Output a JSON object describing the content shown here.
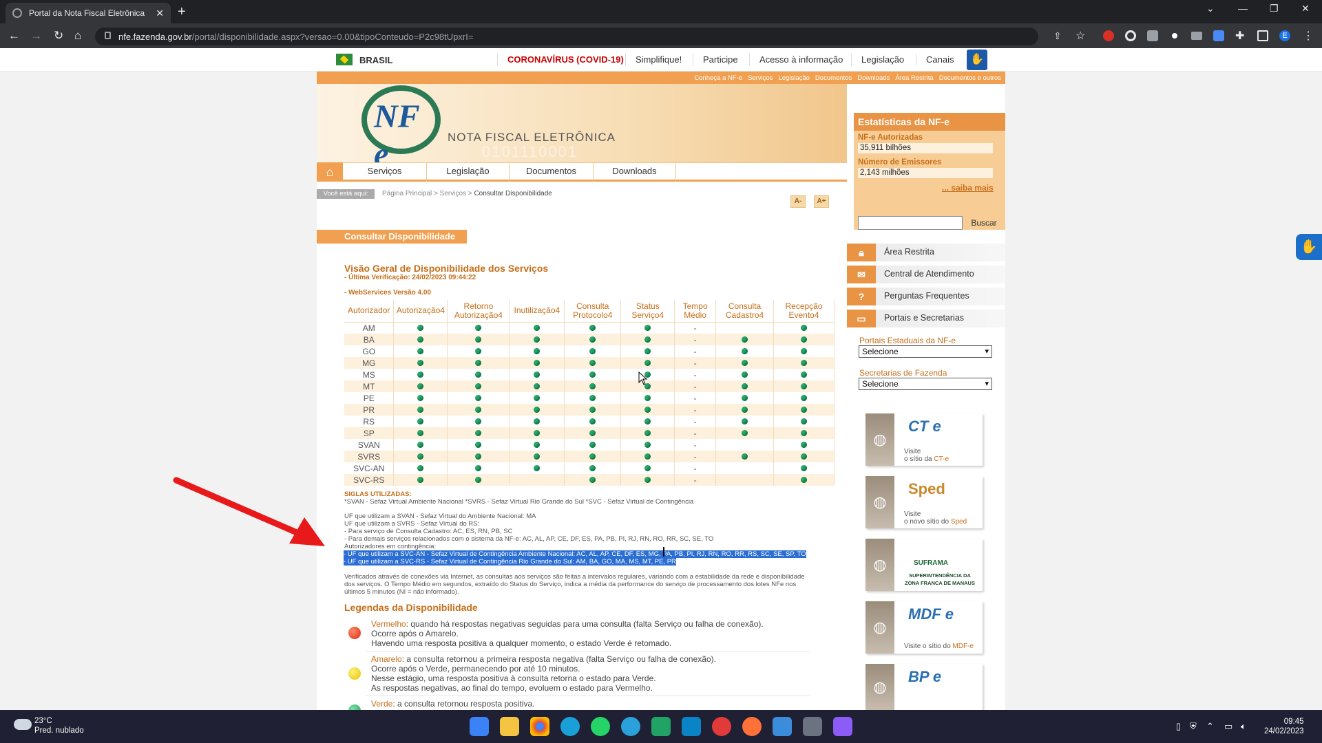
{
  "browser": {
    "tab_title": "Portal da Nota Fiscal Eletrônica",
    "tab_close": "✕",
    "new_tab": "+",
    "url_domain": "nfe.fazenda.gov.br",
    "url_path": "/portal/disponibilidade.aspx?versao=0.00&tipoConteudo=P2c98tUpxrI="
  },
  "gov_bar": {
    "country": "BRASIL",
    "links": [
      "CORONAVÍRUS (COVID-19)",
      "Simplifique!",
      "Participe",
      "Acesso à informação",
      "Legislação",
      "Canais"
    ]
  },
  "top_strip": [
    "Conheça a NF-e",
    "Serviços",
    "Legislação",
    "Documentos",
    "Downloads",
    "Área Restrita",
    "Documentos e outros"
  ],
  "banner": {
    "logo_text": "NF e",
    "title": "NOTA FISCAL ELETRÔNICA",
    "bits": "0101110001"
  },
  "menu": {
    "home_icon": "⌂",
    "items": [
      "Serviços",
      "Legislação",
      "Documentos",
      "Downloads"
    ]
  },
  "breadcrumb": {
    "label": "Você está aqui:",
    "home": "Página Principal",
    "sep": ">",
    "section": "Serviços",
    "current": "Consultar Disponibilidade"
  },
  "font_buttons": {
    "decrease": "A-",
    "increase": "A+"
  },
  "page_title": "Consultar Disponibilidade",
  "heading": "Visão Geral de Disponibilidade dos Serviços",
  "last_check": "- Última Verificação: 24/02/2023 09:44:22",
  "ws_version": "- WebServices Versão 4.00",
  "table": {
    "headers": [
      "Autorizador",
      "Autorização4",
      "Retorno Autorização4",
      "Inutilização4",
      "Consulta Protocolo4",
      "Status Serviço4",
      "Tempo Médio",
      "Consulta Cadastro4",
      "Recepção Evento4"
    ],
    "rows": [
      [
        "AM",
        "g",
        "g",
        "g",
        "g",
        "g",
        "-",
        "",
        "g"
      ],
      [
        "BA",
        "g",
        "g",
        "g",
        "g",
        "g",
        "-",
        "g",
        "g"
      ],
      [
        "GO",
        "g",
        "g",
        "g",
        "g",
        "g",
        "-",
        "g",
        "g"
      ],
      [
        "MG",
        "g",
        "g",
        "g",
        "g",
        "g",
        "-",
        "g",
        "g"
      ],
      [
        "MS",
        "g",
        "g",
        "g",
        "g",
        "g",
        "-",
        "g",
        "g"
      ],
      [
        "MT",
        "g",
        "g",
        "g",
        "g",
        "g",
        "-",
        "g",
        "g"
      ],
      [
        "PE",
        "g",
        "g",
        "g",
        "g",
        "g",
        "-",
        "g",
        "g"
      ],
      [
        "PR",
        "g",
        "g",
        "g",
        "g",
        "g",
        "-",
        "g",
        "g"
      ],
      [
        "RS",
        "g",
        "g",
        "g",
        "g",
        "g",
        "-",
        "g",
        "g"
      ],
      [
        "SP",
        "g",
        "g",
        "g",
        "g",
        "g",
        "-",
        "g",
        "g"
      ],
      [
        "SVAN",
        "g",
        "g",
        "g",
        "g",
        "g",
        "-",
        "",
        "g"
      ],
      [
        "SVRS",
        "g",
        "g",
        "g",
        "g",
        "g",
        "-",
        "g",
        "g"
      ],
      [
        "SVC-AN",
        "g",
        "g",
        "g",
        "g",
        "g",
        "-",
        "",
        "g"
      ],
      [
        "SVC-RS",
        "g",
        "g",
        "",
        "g",
        "g",
        "-",
        "",
        "g"
      ]
    ]
  },
  "notes": {
    "siglas_title": "SIGLAS UTILIZADAS:",
    "siglas": "*SVAN - Sefaz Virtual Ambiente Nacional *SVRS - Sefaz Virtual Rio Grande do Sul *SVC - Sefaz Virtual de Contingência",
    "l1": "UF que utilizam a SVAN - Sefaz Virtual do Ambiente Nacional: MA",
    "l2": "UF que utilizam a SVRS - Sefaz Virtual do RS:",
    "l3": "- Para serviço de Consulta Cadastro: AC, ES, RN, PB, SC",
    "l4": "- Para demais serviços relacionados com o sistema da NF-e: AC, AL, AP, CE, DF, ES, PA, PB, PI, RJ, RN, RO, RR, SC, SE, TO",
    "l5": "Autorizadores em contingência:",
    "hl1": "- UF que utilizam a SVC-AN - Sefaz Virtual de Contingência Ambiente Nacional: AC, AL, AP, CE, DF, ES, MG, PA, PB, PI, RJ, RN, RO, RR, RS, SC, SE, SP, TO",
    "hl2": "- UF que utilizam a SVC-RS - Sefaz Virtual de Contingência Rio Grande do Sul: AM, BA, GO, MA, MS, MT, PE, PR",
    "p1": "Verificados através de conexões via Internet, as consultas aos serviços são feitas a intervalos regulares, variando com a estabilidade da rede e disponibilidade",
    "p2": "dos serviços. O Tempo Médio em segundos, extraído do Status do Serviço, indica a média da performance do serviço de processamento dos lotes NFe nos",
    "p3": "últimos 5 minutos (NI = não informado)."
  },
  "legend": {
    "title": "Legendas da Disponibilidade",
    "red_name": "Vermelho",
    "red_1": ": quando há respostas negativas seguidas para uma consulta (falta Serviço ou falha de conexão).",
    "red_2": "Ocorre após o Amarelo.",
    "red_3": "Havendo uma resposta positiva a qualquer momento, o estado Verde é retomado.",
    "yellow_name": "Amarelo",
    "yellow_1": ": a consulta retornou a primeira resposta negativa (falta Serviço ou falha de conexão).",
    "yellow_2": "Ocorre após o Verde, permanecendo por até 10 minutos.",
    "yellow_3": " Nesse estágio, uma resposta positiva à consulta retorna o estado para Verde.",
    "yellow_4": "As respostas negativas, ao final do tempo, evoluem o estado para Vermelho.",
    "green_name": "Verde",
    "green_1": ": a consulta retornou resposta positiva."
  },
  "stats": {
    "title": "Estatísticas da NF-e",
    "auth_label": "NF-e Autorizadas",
    "auth_value": "35,911 bilhões",
    "emit_label": "Número de Emissores",
    "emit_value": "2,143 milhões",
    "more": "... saiba mais"
  },
  "search": {
    "button": "Buscar"
  },
  "side_menu": [
    {
      "label": "Área Restrita",
      "icon": "lock-icon"
    },
    {
      "label": "Central de Atendimento",
      "icon": "mail-icon"
    },
    {
      "label": "Perguntas Frequentes",
      "icon": "question-icon"
    },
    {
      "label": "Portais e Secretarias",
      "icon": "window-icon"
    }
  ],
  "selects": {
    "portais_label": "Portais Estaduais da NF-e",
    "portais_value": "Selecione",
    "secretarias_label": "Secretarias de Fazenda",
    "secretarias_value": "Selecione"
  },
  "sites": [
    {
      "logo": "CT e",
      "visit": "Visite",
      "desc": "o sítio da",
      "name": "CT-e"
    },
    {
      "logo": "Sped",
      "visit": "Visite",
      "desc": "o novo sítio do",
      "name": "Sped"
    },
    {
      "logo": "SUFRAMA",
      "visit": "SUPERINTENDÊNCIA DA ZONA FRANCA DE MANAUS",
      "desc": "",
      "name": ""
    },
    {
      "logo": "MDF e",
      "visit": "Visite o sítio do",
      "desc": "",
      "name": "MDF-e"
    },
    {
      "logo": "BP e",
      "visit": "",
      "desc": "",
      "name": ""
    }
  ],
  "taskbar": {
    "temp": "23°C",
    "weather": "Pred. nublado",
    "time": "09:45",
    "date": "24/02/2023"
  },
  "colors": {
    "accent": "#f0a050",
    "orange_text": "#c66e18",
    "status_green": "#2aa56a",
    "highlight": "#2a6ed4",
    "arrow": "#e8191a"
  }
}
